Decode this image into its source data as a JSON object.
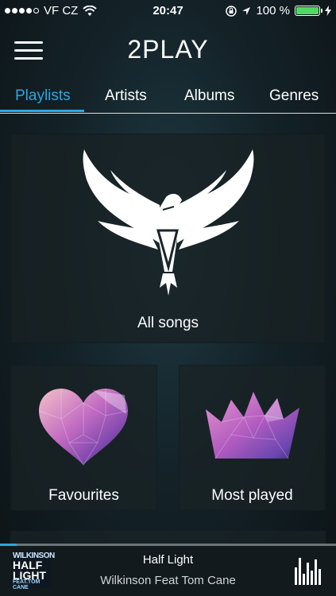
{
  "status": {
    "carrier": "VF CZ",
    "time": "20:47",
    "battery": "100 %"
  },
  "app": {
    "logo": "2PLAY"
  },
  "tabs": [
    {
      "label": "Playlists",
      "active": true
    },
    {
      "label": "Artists"
    },
    {
      "label": "Albums"
    },
    {
      "label": "Genres"
    }
  ],
  "cards": {
    "all_songs": "All songs",
    "favourites": "Favourites",
    "most_played": "Most played"
  },
  "player": {
    "title": "Half Light",
    "artist": "Wilkinson Feat Tom Cane",
    "progress": 0.05,
    "cover": {
      "line1": "WILKINSON",
      "line2a": "HALF",
      "line2b": "LIGHT",
      "line3": "FEAT.TOM CANE"
    }
  },
  "colors": {
    "accent": "#28a8e0",
    "battery": "#4cd964"
  },
  "icons": [
    "menu-icon",
    "wifi-icon",
    "lock-rotation-icon",
    "location-icon",
    "battery-icon",
    "eagle-icon",
    "heart-icon",
    "crown-icon",
    "equalizer-icon"
  ]
}
